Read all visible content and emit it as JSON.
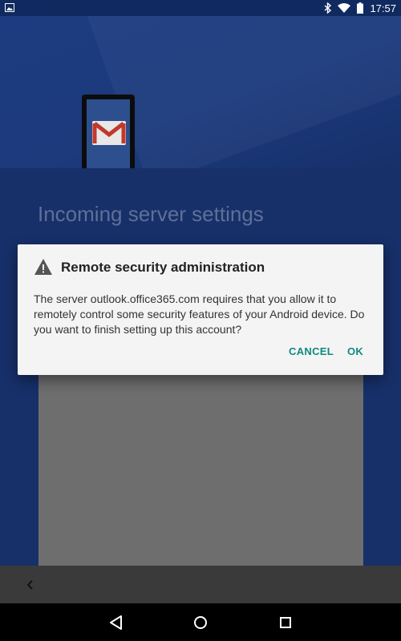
{
  "status_bar": {
    "time": "17:57",
    "icons": [
      "image-icon",
      "bluetooth-icon",
      "wifi-icon",
      "battery-icon"
    ]
  },
  "page": {
    "title": "Incoming server settings",
    "illustration": "gmail-phone-icon"
  },
  "dialog": {
    "title": "Remote security administration",
    "title_icon": "warning-icon",
    "message": "The server outlook.office365.com requires that you allow it to remotely control some security features of your Android device. Do you want to finish setting up this account?",
    "cancel_label": "CANCEL",
    "ok_label": "OK",
    "accent_color": "#0e8a7e"
  },
  "bottom_bar": {
    "back_icon": "chevron-left-icon"
  },
  "nav_bar": {
    "buttons": [
      "nav-back-icon",
      "nav-home-icon",
      "nav-recents-icon"
    ]
  }
}
